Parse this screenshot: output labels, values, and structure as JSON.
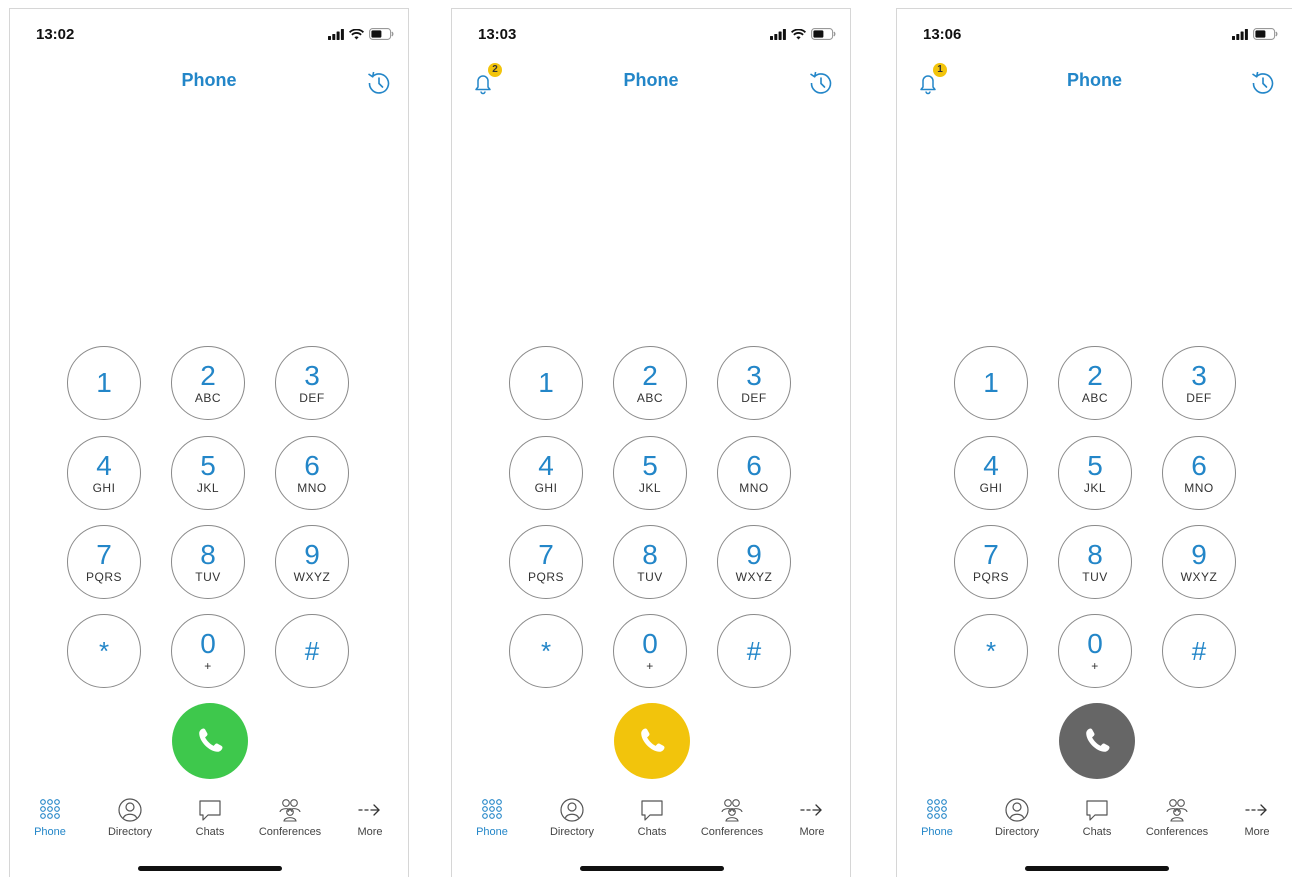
{
  "accent_color": "#2386c8",
  "screens": [
    {
      "status": {
        "time": "13:02",
        "wifi": true
      },
      "header": {
        "title": "Phone",
        "bell": false,
        "badge": ""
      },
      "call_button": {
        "color": "#3ec84c",
        "icon": "phone-handset-icon"
      }
    },
    {
      "status": {
        "time": "13:03",
        "wifi": true
      },
      "header": {
        "title": "Phone",
        "bell": true,
        "badge": "2"
      },
      "call_button": {
        "color": "#f2c40c",
        "icon": "phone-handset-icon"
      }
    },
    {
      "status": {
        "time": "13:06",
        "wifi": false
      },
      "header": {
        "title": "Phone",
        "bell": true,
        "badge": "1"
      },
      "call_button": {
        "color": "#666666",
        "icon": "phone-handset-icon"
      }
    }
  ],
  "keypad": [
    {
      "digit": "1",
      "letters": ""
    },
    {
      "digit": "2",
      "letters": "ABC"
    },
    {
      "digit": "3",
      "letters": "DEF"
    },
    {
      "digit": "4",
      "letters": "GHI"
    },
    {
      "digit": "5",
      "letters": "JKL"
    },
    {
      "digit": "6",
      "letters": "MNO"
    },
    {
      "digit": "7",
      "letters": "PQRS"
    },
    {
      "digit": "8",
      "letters": "TUV"
    },
    {
      "digit": "9",
      "letters": "WXYZ"
    },
    {
      "digit": "*",
      "letters": ""
    },
    {
      "digit": "0",
      "letters": "+"
    },
    {
      "digit": "#",
      "letters": ""
    }
  ],
  "tabs": [
    {
      "label": "Phone",
      "icon": "dialpad-icon",
      "active": true
    },
    {
      "label": "Directory",
      "icon": "person-icon",
      "active": false
    },
    {
      "label": "Chats",
      "icon": "chat-bubble-icon",
      "active": false
    },
    {
      "label": "Conferences",
      "icon": "group-icon",
      "active": false
    },
    {
      "label": "More",
      "icon": "arrow-right-icon",
      "active": false
    }
  ]
}
